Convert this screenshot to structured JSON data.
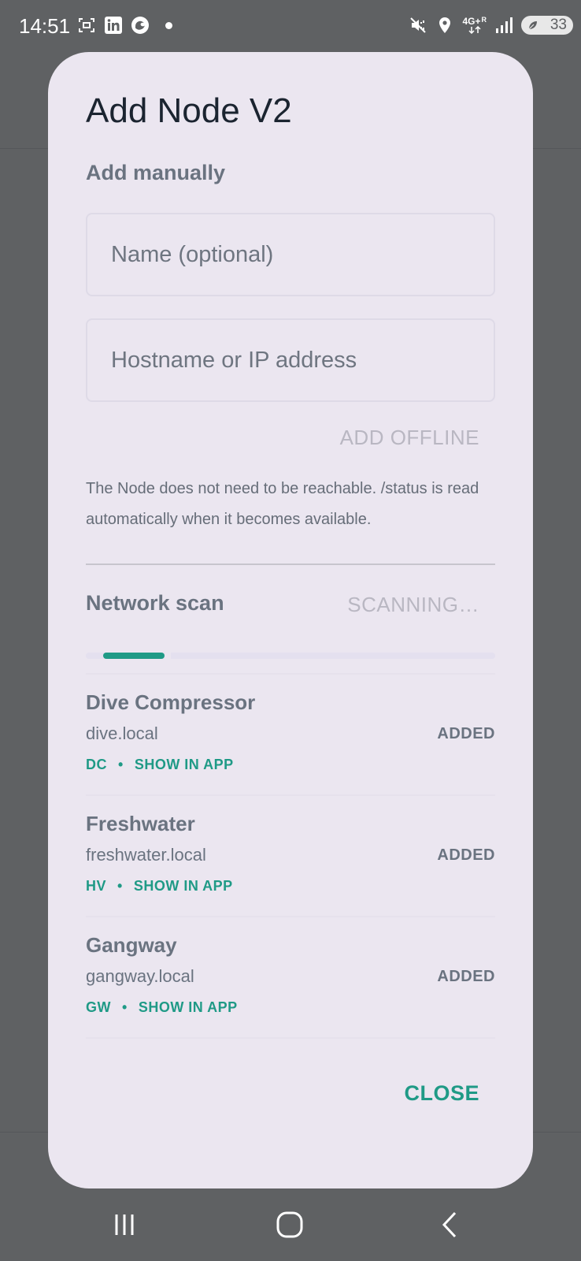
{
  "status_bar": {
    "time": "14:51",
    "network": "4G+",
    "roaming": "R",
    "battery": "33"
  },
  "dialog": {
    "title": "Add Node V2",
    "manual": {
      "label": "Add manually",
      "name_placeholder": "Name (optional)",
      "host_placeholder": "Hostname or IP address",
      "add_offline_label": "ADD OFFLINE",
      "helper_text": "The Node does not need to be reachable. /status is read automatically when it becomes available."
    },
    "scan": {
      "label": "Network scan",
      "scan_button_label": "SCANNING…",
      "progress_segment": 0.15
    },
    "nodes": [
      {
        "name": "Dive Compressor",
        "host": "dive.local",
        "status": "ADDED",
        "short_code": "DC",
        "separator": "•",
        "action": "SHOW IN APP"
      },
      {
        "name": "Freshwater",
        "host": "freshwater.local",
        "status": "ADDED",
        "short_code": "HV",
        "separator": "•",
        "action": "SHOW IN APP"
      },
      {
        "name": "Gangway",
        "host": "gangway.local",
        "status": "ADDED",
        "short_code": "GW",
        "separator": "•",
        "action": "SHOW IN APP"
      }
    ],
    "close_label": "CLOSE"
  },
  "colors": {
    "accent": "#1f9a86",
    "dialog_bg": "#ebe6f0",
    "scrim": "#5f6163"
  },
  "nav_bar": {
    "recents_icon": "recents-icon",
    "home_icon": "home-icon",
    "back_icon": "back-icon"
  }
}
